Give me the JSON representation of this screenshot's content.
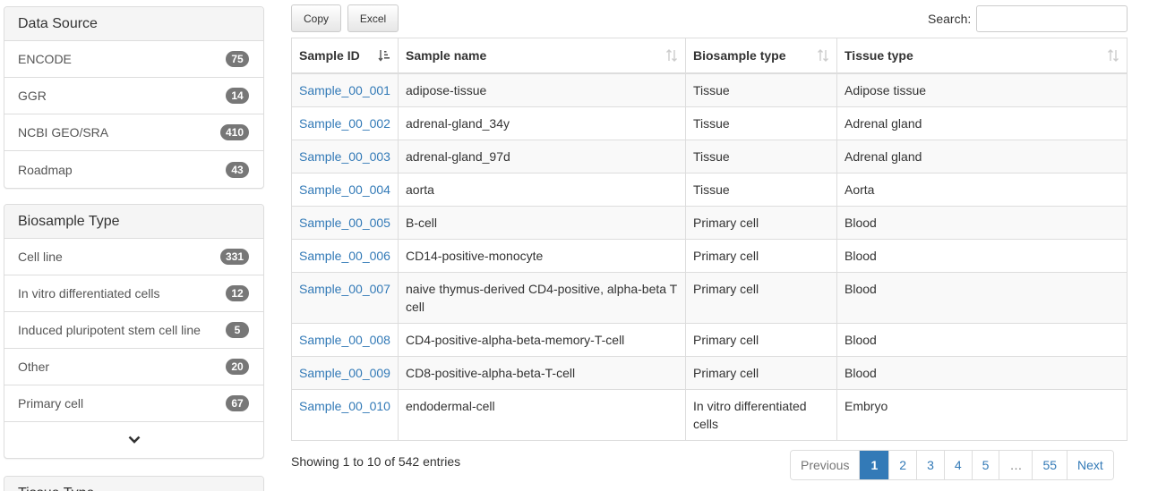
{
  "sidebar": {
    "data_source": {
      "title": "Data Source",
      "items": [
        {
          "label": "ENCODE",
          "count": "75"
        },
        {
          "label": "GGR",
          "count": "14"
        },
        {
          "label": "NCBI GEO/SRA",
          "count": "410"
        },
        {
          "label": "Roadmap",
          "count": "43"
        }
      ]
    },
    "biosample_type": {
      "title": "Biosample Type",
      "items": [
        {
          "label": "Cell line",
          "count": "331"
        },
        {
          "label": "In vitro differentiated cells",
          "count": "12"
        },
        {
          "label": "Induced pluripotent stem cell line",
          "count": "5"
        },
        {
          "label": "Other",
          "count": "20"
        },
        {
          "label": "Primary cell",
          "count": "67"
        }
      ],
      "more_icon": "chevron-down-icon"
    },
    "tissue_type": {
      "title": "Tissue Type"
    }
  },
  "toolbar": {
    "copy_label": "Copy",
    "excel_label": "Excel",
    "search_label": "Search:",
    "search_value": ""
  },
  "table": {
    "columns": [
      "Sample ID",
      "Sample name",
      "Biosample type",
      "Tissue type"
    ],
    "rows": [
      [
        "Sample_00_001",
        "adipose-tissue",
        "Tissue",
        "Adipose tissue"
      ],
      [
        "Sample_00_002",
        "adrenal-gland_34y",
        "Tissue",
        "Adrenal gland"
      ],
      [
        "Sample_00_003",
        "adrenal-gland_97d",
        "Tissue",
        "Adrenal gland"
      ],
      [
        "Sample_00_004",
        "aorta",
        "Tissue",
        "Aorta"
      ],
      [
        "Sample_00_005",
        "B-cell",
        "Primary cell",
        "Blood"
      ],
      [
        "Sample_00_006",
        "CD14-positive-monocyte",
        "Primary cell",
        "Blood"
      ],
      [
        "Sample_00_007",
        "naive thymus-derived CD4-positive, alpha-beta T cell",
        "Primary cell",
        "Blood"
      ],
      [
        "Sample_00_008",
        "CD4-positive-alpha-beta-memory-T-cell",
        "Primary cell",
        "Blood"
      ],
      [
        "Sample_00_009",
        "CD8-positive-alpha-beta-T-cell",
        "Primary cell",
        "Blood"
      ],
      [
        "Sample_00_010",
        "endodermal-cell",
        "In vitro differentiated cells",
        "Embryo"
      ]
    ]
  },
  "footer": {
    "info": "Showing 1 to 10 of 542 entries",
    "pagination": {
      "previous": "Previous",
      "pages": [
        "1",
        "2",
        "3",
        "4",
        "5",
        "…",
        "55"
      ],
      "active": "1",
      "next": "Next"
    }
  },
  "colors": {
    "link": "#337ab7",
    "badge": "#777777",
    "active_page": "#337ab7"
  }
}
